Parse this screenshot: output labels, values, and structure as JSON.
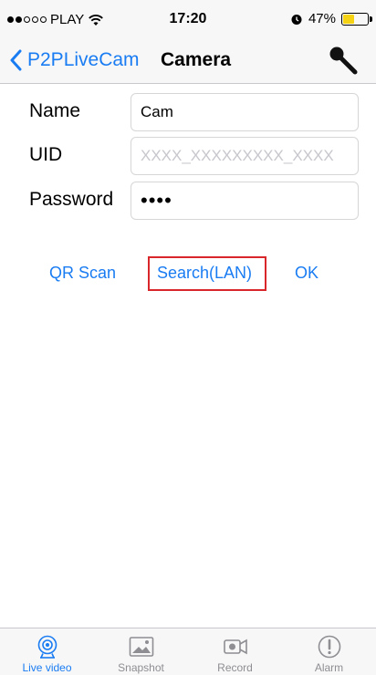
{
  "status_bar": {
    "carrier": "PLAY",
    "time": "17:20",
    "battery": "47%",
    "battery_level": 0.47
  },
  "nav": {
    "back_label": "P2PLiveCam",
    "title": "Camera"
  },
  "form": {
    "name_label": "Name",
    "name_value": "Cam",
    "uid_label": "UID",
    "uid_placeholder": "XXXX_XXXXXXXXX_XXXX",
    "password_label": "Password",
    "password_value": "••••"
  },
  "actions": {
    "qr_scan": "QR Scan",
    "search_lan": "Search(LAN)",
    "ok": "OK"
  },
  "tabs": [
    {
      "label": "Live video",
      "icon": "live-video-icon",
      "active": true
    },
    {
      "label": "Snapshot",
      "icon": "snapshot-icon",
      "active": false
    },
    {
      "label": "Record",
      "icon": "record-icon",
      "active": false
    },
    {
      "label": "Alarm",
      "icon": "alarm-icon",
      "active": false
    }
  ],
  "colors": {
    "accent": "#1a7cf2",
    "highlight": "#d9262a",
    "inactive": "#8e8e93"
  }
}
